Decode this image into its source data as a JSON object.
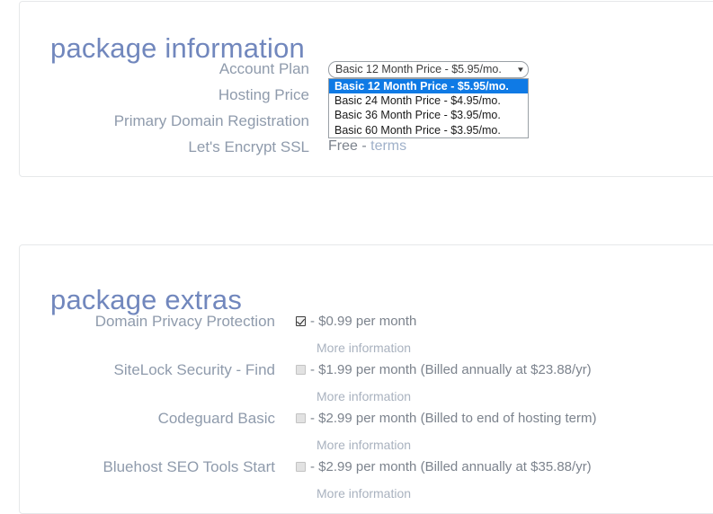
{
  "package_information": {
    "heading": "package information",
    "rows": [
      {
        "label": "Account Plan"
      },
      {
        "label": "Hosting Price"
      },
      {
        "label": "Primary Domain Registration"
      },
      {
        "label": "Let's Encrypt SSL"
      }
    ],
    "account_plan_select": {
      "value": "Basic 12 Month Price - $5.95/mo.",
      "caret_icon": "chevron-down-icon",
      "expanded": true,
      "options": [
        "Basic 12 Month Price - $5.95/mo.",
        "Basic 24 Month Price - $4.95/mo.",
        "Basic 36 Month Price - $3.95/mo.",
        "Basic 60 Month Price - $3.95/mo."
      ],
      "selected_index": 0
    },
    "ssl_value_prefix": "Free - ",
    "ssl_terms_link": "terms"
  },
  "package_extras": {
    "heading": "package extras",
    "more_information_label": "More information",
    "items": [
      {
        "label": "Domain Privacy Protection",
        "checked": true,
        "price_text": "- $0.99 per month",
        "more_information": "More information"
      },
      {
        "label": "SiteLock Security - Find",
        "checked": false,
        "price_text": "- $1.99 per month (Billed annually at $23.88/yr)",
        "more_information": "More information"
      },
      {
        "label": "Codeguard Basic",
        "checked": false,
        "price_text": "- $2.99 per month (Billed to end of hosting term)",
        "more_information": "More information"
      },
      {
        "label": "Bluehost SEO Tools Start",
        "checked": false,
        "price_text": "- $2.99 per month (Billed annually at $35.88/yr)",
        "more_information": "More information"
      }
    ]
  },
  "colors": {
    "heading": "#7187bd",
    "label": "#8f9bac",
    "value": "#7c838d",
    "link": "#a9b2bf",
    "highlight": "#0f7ae5",
    "panel_border": "#e6e8ea"
  }
}
